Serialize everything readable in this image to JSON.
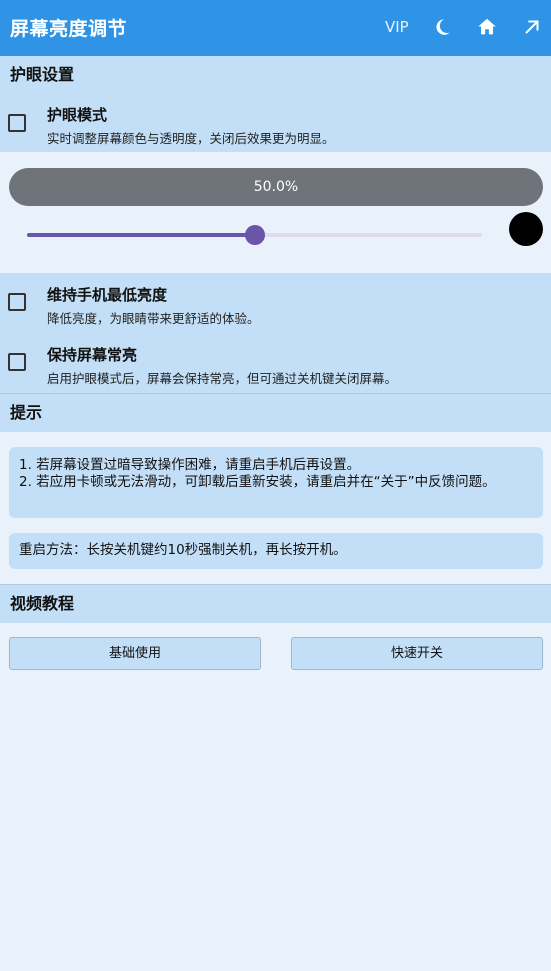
{
  "appbar": {
    "title": "屏幕亮度调节",
    "vip": "VIP",
    "icons": [
      "moon-icon",
      "home-icon",
      "arrow-up-right-icon"
    ],
    "color": "#2f93e6"
  },
  "eye_protection": {
    "header": "护眼设置",
    "mode": {
      "title": "护眼模式",
      "desc": "实时调整屏幕颜色与透明度，关闭后效果更为明显。",
      "checked": false
    },
    "brightness": {
      "label": "50.0%",
      "value": 0.5
    },
    "filter_color": "#000000",
    "min_brightness": {
      "title": "维持手机最低亮度",
      "desc": "降低亮度，为眼睛带来更舒适的体验。",
      "checked": false
    },
    "keep_on": {
      "title": "保持屏幕常亮",
      "desc": "启用护眼模式后，屏幕会保持常亮，但可通过关机键关闭屏幕。",
      "checked": false
    }
  },
  "tips": {
    "header": "提示",
    "line1": "1. 若屏幕设置过暗导致操作困难，请重启手机后再设置。",
    "line2": "2. 若应用卡顿或无法滑动，可卸载后重新安装，请重启并在“关于”中反馈问题。",
    "restart": "重启方法：长按关机键约10秒强制关机，再长按开机。"
  },
  "video": {
    "header": "视频教程",
    "basic_label": "基础使用",
    "quick_label": "快速开关"
  }
}
